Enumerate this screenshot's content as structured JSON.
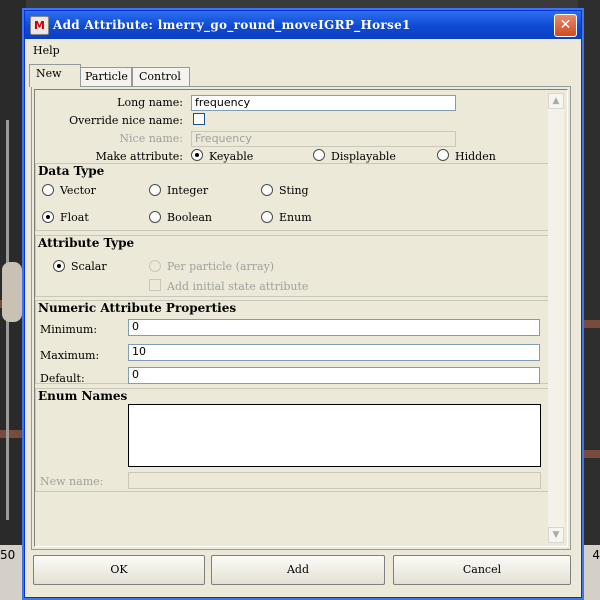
{
  "window": {
    "title": "Add Attribute: lmerry_go_round_moveIGRP_Horse1",
    "app_icon": "maya-app-icon",
    "close": "✕"
  },
  "menu": {
    "help": "Help"
  },
  "tabs": [
    {
      "label": "New"
    },
    {
      "label": "Particle"
    },
    {
      "label": "Control"
    }
  ],
  "form": {
    "long_name_label": "Long name:",
    "long_name_value": "frequency",
    "override_label": "Override nice name:",
    "nice_name_label": "Nice name:",
    "nice_name_value": "Frequency",
    "make_attr_label": "Make attribute:",
    "make_options": [
      "Keyable",
      "Displayable",
      "Hidden"
    ],
    "make_selected": "Keyable"
  },
  "data_type": {
    "title": "Data Type",
    "options": [
      "Vector",
      "Integer",
      "Sting",
      "Float",
      "Boolean",
      "Enum"
    ],
    "selected": "Float"
  },
  "attribute_type": {
    "title": "Attribute Type",
    "scalar": "Scalar",
    "per_particle": "Per particle (array)",
    "add_initial": "Add initial state attribute"
  },
  "numeric": {
    "title": "Numeric Attribute Properties",
    "minimum_label": "Minimum:",
    "minimum_value": "0",
    "maximum_label": "Maximum:",
    "maximum_value": "10",
    "default_label": "Default:",
    "default_value": "0"
  },
  "enum": {
    "title": "Enum Names",
    "new_name_label": "New name:"
  },
  "buttons": {
    "ok": "OK",
    "add": "Add",
    "cancel": "Cancel"
  },
  "background": {
    "left_number": "50",
    "right_number": "4"
  },
  "colors": {
    "title_bar": "#0f4ad4",
    "dialog_bg": "#ece9d8",
    "close_button": "#d04a24"
  }
}
